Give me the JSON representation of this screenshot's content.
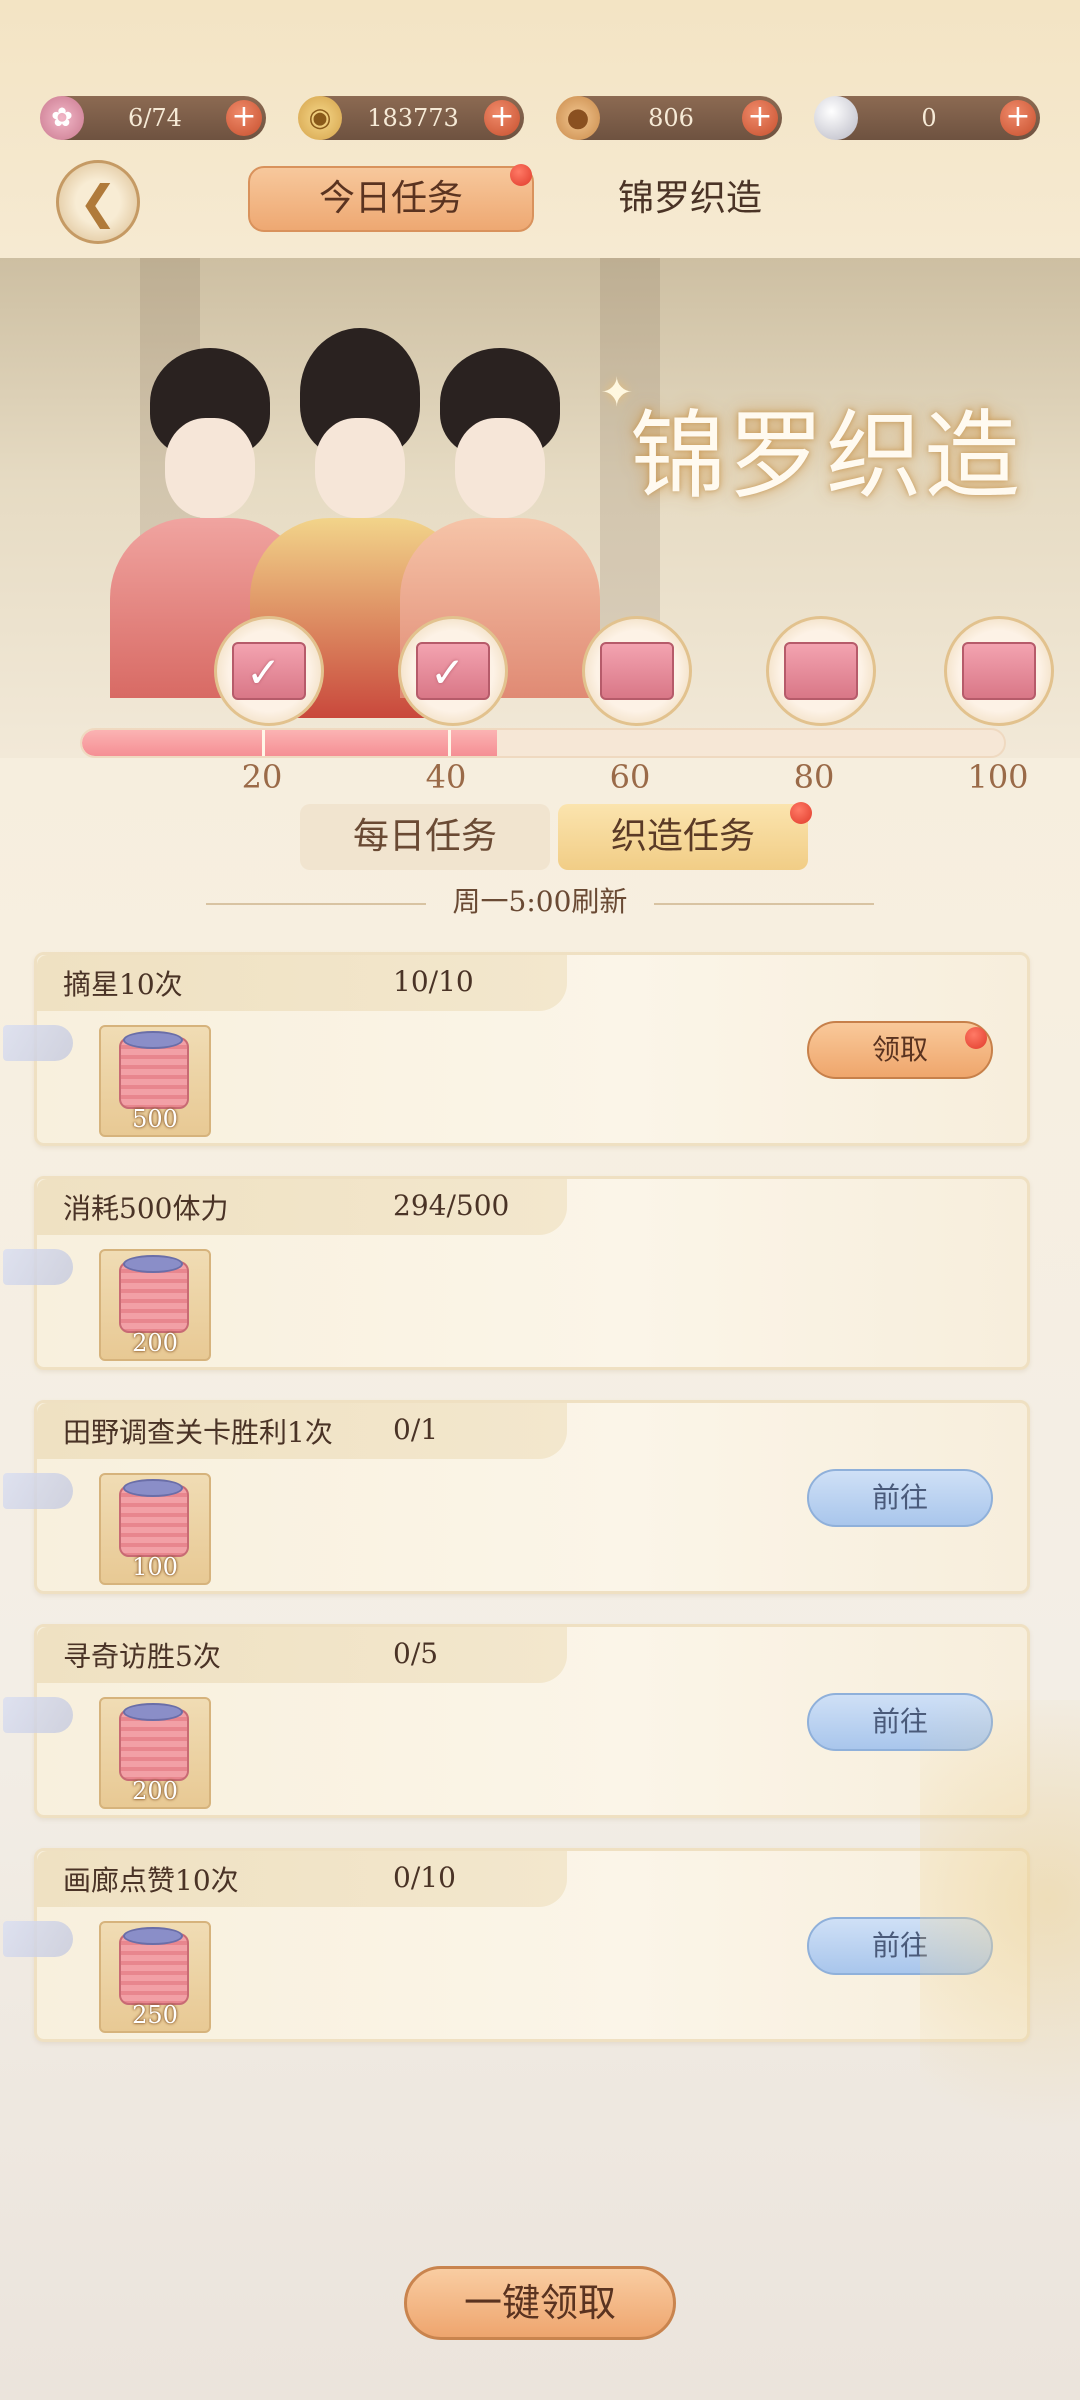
{
  "resources": [
    {
      "icon": "lotus-stamina-icon",
      "value": "6/74"
    },
    {
      "icon": "gold-coin-icon",
      "value": "183773"
    },
    {
      "icon": "copper-coin-icon",
      "value": "806"
    },
    {
      "icon": "pearl-icon",
      "value": "0"
    }
  ],
  "header": {
    "tabs": [
      "今日任务",
      "锦罗织造"
    ],
    "active_tab": "今日任务"
  },
  "banner": {
    "title": "锦罗织造"
  },
  "progress": {
    "value": 45,
    "max": 100,
    "milestones": [
      "20",
      "40",
      "60",
      "80",
      "100"
    ],
    "claimed_chests": 2
  },
  "subtabs": {
    "daily": "每日任务",
    "weave": "织造任务",
    "active": "织造任务"
  },
  "refresh_text": "周一5:00刷新",
  "tasks": [
    {
      "name": "摘星10次",
      "progress": "10/10",
      "reward": "500",
      "button": "领取",
      "state": "claim"
    },
    {
      "name": "消耗500体力",
      "progress": "294/500",
      "reward": "200",
      "button": "",
      "state": "none"
    },
    {
      "name": "田野调查关卡胜利1次",
      "progress": "0/1",
      "reward": "100",
      "button": "前往",
      "state": "go"
    },
    {
      "name": "寻奇访胜5次",
      "progress": "0/5",
      "reward": "200",
      "button": "前往",
      "state": "go"
    },
    {
      "name": "画廊点赞10次",
      "progress": "0/10",
      "reward": "250",
      "button": "前往",
      "state": "go"
    }
  ],
  "claim_all_label": "一键领取",
  "colors": {
    "accent_orange": "#eea872",
    "go_blue": "#a9c6ec",
    "progress_pink": "#f58f94",
    "notify_red": "#e03b2b"
  }
}
